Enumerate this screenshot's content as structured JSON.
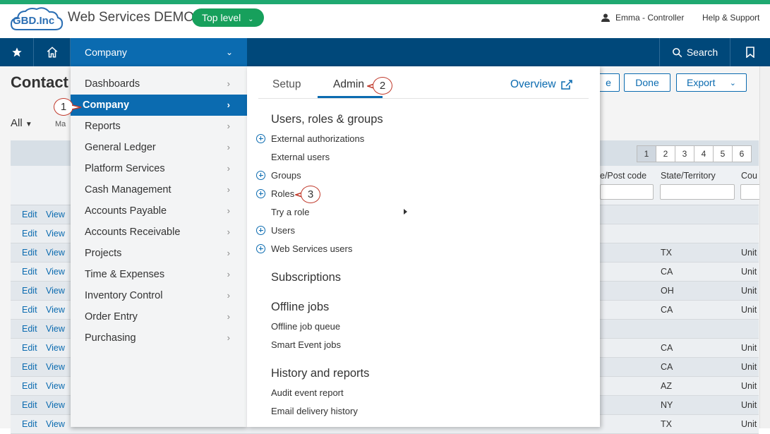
{
  "header": {
    "logo_text": "GBD.Inc",
    "app_title": "Web Services DEMO",
    "level_selector": "Top level",
    "user": "Emma - Controller",
    "help": "Help & Support"
  },
  "navbar": {
    "company_label": "Company",
    "search_label": "Search"
  },
  "page": {
    "title": "Contact",
    "buttons": {
      "partial": "e",
      "done": "Done",
      "export": "Export"
    },
    "filter_all": "All",
    "filter_partial": "Ma",
    "pager": [
      "1",
      "2",
      "3",
      "4",
      "5",
      "6"
    ],
    "columns": [
      "e/Post code",
      "State/Territory",
      "Cou"
    ],
    "rows": [
      {
        "edit": "Edit",
        "view": "View",
        "state": "",
        "country": ""
      },
      {
        "edit": "Edit",
        "view": "View",
        "state": "",
        "country": ""
      },
      {
        "edit": "Edit",
        "view": "View",
        "state": "TX",
        "country": "Unit"
      },
      {
        "edit": "Edit",
        "view": "View",
        "state": "CA",
        "country": "Unit"
      },
      {
        "edit": "Edit",
        "view": "View",
        "state": "OH",
        "country": "Unit"
      },
      {
        "edit": "Edit",
        "view": "View",
        "state": "CA",
        "country": "Unit"
      },
      {
        "edit": "Edit",
        "view": "View",
        "state": "",
        "country": ""
      },
      {
        "edit": "Edit",
        "view": "View",
        "state": "CA",
        "country": "Unit"
      },
      {
        "edit": "Edit",
        "view": "View",
        "state": "CA",
        "country": "Unit"
      },
      {
        "edit": "Edit",
        "view": "View",
        "state": "AZ",
        "country": "Unit"
      },
      {
        "edit": "Edit",
        "view": "View",
        "state": "NY",
        "country": "Unit"
      },
      {
        "edit": "Edit",
        "view": "View",
        "state": "TX",
        "country": "Unit"
      }
    ]
  },
  "menu": {
    "items": [
      "Dashboards",
      "Company",
      "Reports",
      "General Ledger",
      "Platform Services",
      "Cash Management",
      "Accounts Payable",
      "Accounts Receivable",
      "Projects",
      "Time & Expenses",
      "Inventory Control",
      "Order Entry",
      "Purchasing"
    ],
    "active_item": "Company",
    "tabs": {
      "setup": "Setup",
      "admin": "Admin"
    },
    "overview": "Overview",
    "sections": {
      "users": {
        "title": "Users, roles & groups",
        "items": [
          "External authorizations",
          "External users",
          "Groups",
          "Roles",
          "Try a role",
          "Users",
          "Web Services users"
        ]
      },
      "subscriptions": {
        "title": "Subscriptions"
      },
      "offline": {
        "title": "Offline jobs",
        "items": [
          "Offline job queue",
          "Smart Event jobs"
        ]
      },
      "history": {
        "title": "History and reports",
        "items": [
          "Audit event report",
          "Email delivery history"
        ]
      }
    }
  },
  "callouts": [
    "1",
    "2",
    "3"
  ],
  "colors": {
    "brand_green": "#1fa971",
    "nav_blue": "#00487a",
    "accent_blue": "#0b6bb0",
    "callout_red": "#c0392b"
  }
}
